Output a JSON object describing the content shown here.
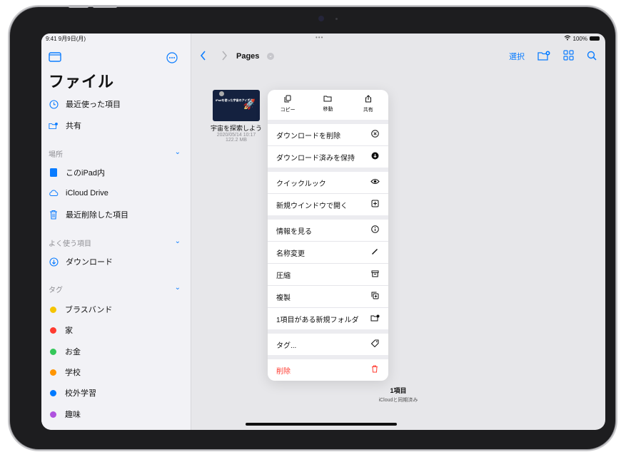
{
  "status": {
    "time": "9:41  9月9日(月)",
    "dots": "•••",
    "battery": "100%"
  },
  "sidebar": {
    "title": "ファイル",
    "items_top": [
      {
        "label": "最近使った項目",
        "icon": "clock-icon"
      },
      {
        "label": "共有",
        "icon": "shared-folder-icon"
      }
    ],
    "locations_header": "場所",
    "locations": [
      {
        "label": "このiPad内",
        "icon": "ipad-icon"
      },
      {
        "label": "iCloud Drive",
        "icon": "cloud-icon"
      },
      {
        "label": "最近削除した項目",
        "icon": "trash-icon"
      }
    ],
    "favorites_header": "よく使う項目",
    "favorites": [
      {
        "label": "ダウンロード",
        "icon": "download-icon"
      }
    ],
    "tags_header": "タグ",
    "tags": [
      {
        "label": "ブラスバンド",
        "color": "#f5c400"
      },
      {
        "label": "家",
        "color": "#ff3b30"
      },
      {
        "label": "お金",
        "color": "#34c759"
      },
      {
        "label": "学校",
        "color": "#ff9500"
      },
      {
        "label": "校外学習",
        "color": "#007aff"
      },
      {
        "label": "趣味",
        "color": "#af52de"
      }
    ]
  },
  "main": {
    "path_title": "Pages",
    "select_label": "選択",
    "file": {
      "name": "宇宙を探索しよう",
      "date": "2020/05/14 10:17",
      "size": "122.2 MB",
      "thumb_text": "iPadを使った宇宙のアイデア"
    },
    "footer_count": "1項目",
    "footer_sync": "iCloudと同期済み"
  },
  "menu": {
    "quick": [
      {
        "label": "コピー",
        "icon": "copy-icon"
      },
      {
        "label": "移動",
        "icon": "folder-icon"
      },
      {
        "label": "共有",
        "icon": "share-icon"
      }
    ],
    "items": [
      {
        "label": "ダウンロードを削除",
        "icon": "x-circle-icon"
      },
      {
        "label": "ダウンロード済みを保持",
        "icon": "down-circle-icon"
      },
      {
        "label": "クイックルック",
        "icon": "eye-icon"
      },
      {
        "label": "新規ウインドウで開く",
        "icon": "plus-square-icon"
      },
      {
        "label": "情報を見る",
        "icon": "info-icon"
      },
      {
        "label": "名称変更",
        "icon": "pencil-icon"
      },
      {
        "label": "圧縮",
        "icon": "archive-icon"
      },
      {
        "label": "複製",
        "icon": "duplicate-icon"
      },
      {
        "label": "1項目がある新規フォルダ",
        "icon": "new-folder-icon"
      },
      {
        "label": "タグ...",
        "icon": "tag-icon"
      },
      {
        "label": "削除",
        "icon": "trash-icon"
      }
    ]
  },
  "colors": {
    "accent": "#0a7cff",
    "danger": "#ff3b30"
  }
}
